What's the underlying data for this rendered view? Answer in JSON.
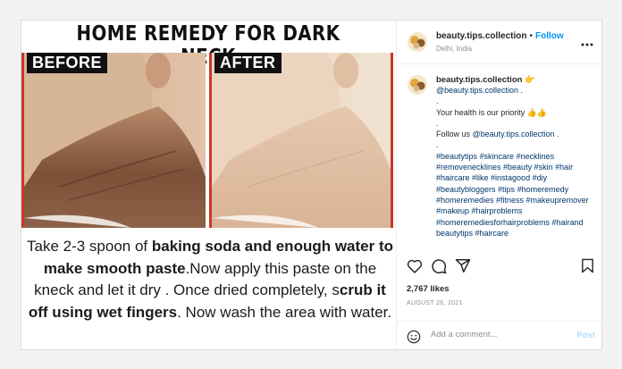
{
  "media": {
    "title": "HOME REMEDY FOR DARK NECK",
    "before_label": "BEFORE",
    "after_label": "AFTER",
    "instructions": {
      "p1": "Take 2-3 spoon of ",
      "b1": "baking soda and enough water to make smooth paste",
      "p2": ".Now apply this paste on the kneck and let it dry . Once dried completely, s",
      "b2": "crub it off using wet fingers",
      "p3": ". Now wash the area with water."
    }
  },
  "header": {
    "username": "beauty.tips.collection",
    "dot": "•",
    "follow": "Follow",
    "location": "Delhi, India",
    "more_icon": "more-icon"
  },
  "caption": {
    "username": "beauty.tips.collection 👉",
    "mention": "@beauty.tips.collection",
    "mention_suffix": " .",
    "dot1": ".",
    "line_health": "Your health is our priority 👍👍",
    "dot2": ".",
    "follow_prefix": "Follow us ",
    "follow_mention": "@beauty.tips.collection",
    "follow_suffix": " .",
    "dot3": ".",
    "hashtags": "#beautytips #skincare #necklines #removenecklines #beauty #skin #hair #haircare #like #instagood #diy #beautybloggers #tips #homeremedy #homeremedies #fitness #makeupremover #makeup #hairproblems #homeremediesforhairproblems #hairand beautytips #haircare"
  },
  "actions": {
    "like_icon": "heart-icon",
    "comment_icon": "comment-icon",
    "share_icon": "share-icon",
    "save_icon": "bookmark-icon"
  },
  "likes": "2,767 likes",
  "date": "AUGUST 26, 2021",
  "comment": {
    "placeholder": "Add a comment...",
    "post": "Post",
    "emoji_icon": "emoji-icon"
  },
  "colors": {
    "link": "#0095f6",
    "hashtag": "#00376b",
    "frame": "#c9372c"
  }
}
